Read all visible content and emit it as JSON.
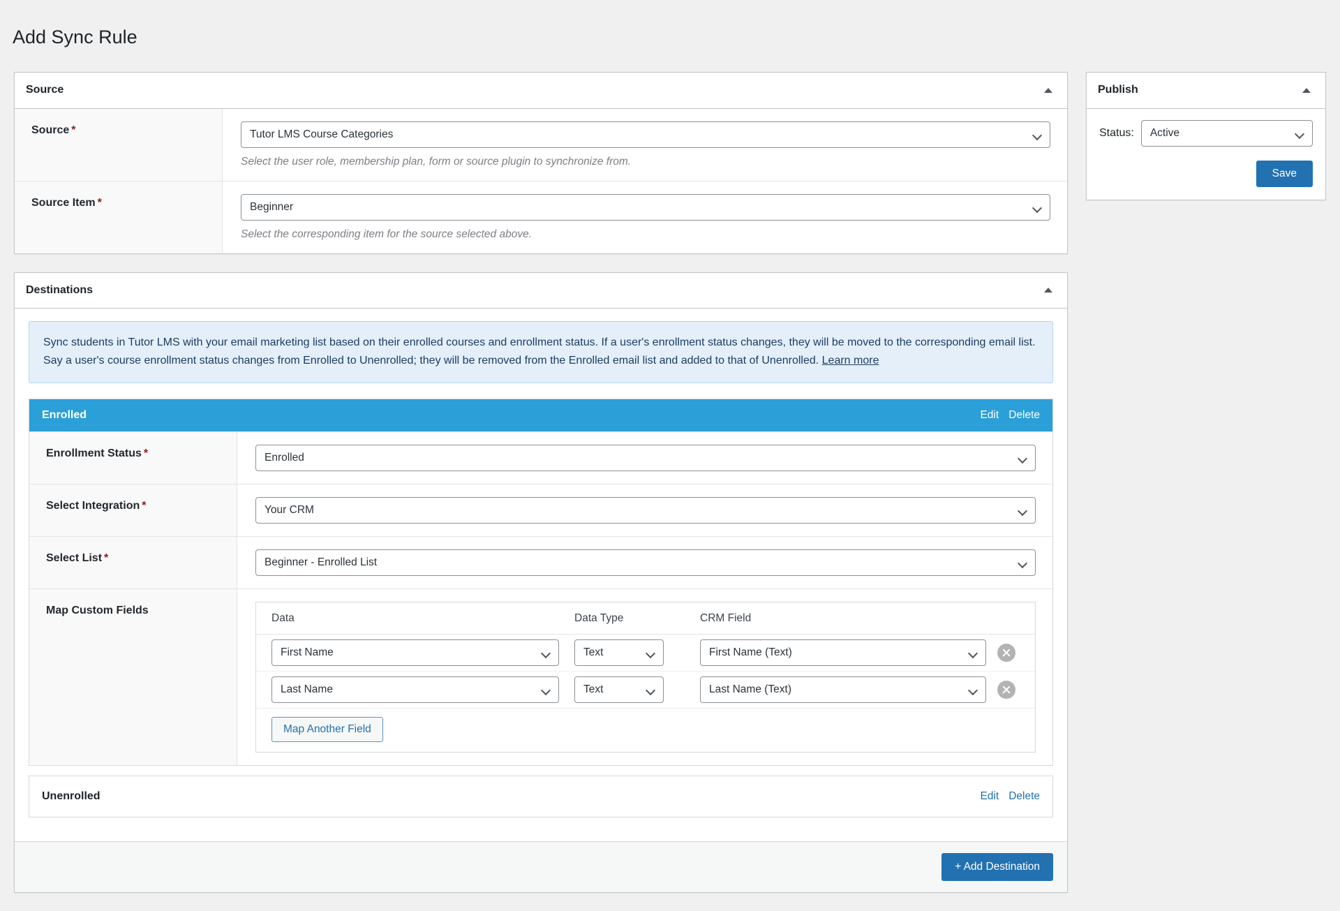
{
  "page": {
    "title": "Add Sync Rule"
  },
  "source_panel": {
    "heading": "Source",
    "toggle_icon": "triangle-up-icon",
    "rows": [
      {
        "label": "Source",
        "required": "*",
        "value": "Tutor LMS Course Categories",
        "help": "Select the user role, membership plan, form or source plugin to synchronize from."
      },
      {
        "label": "Source Item",
        "required": "*",
        "value": "Beginner",
        "help": "Select the corresponding item for the source selected above."
      }
    ]
  },
  "destinations_panel": {
    "heading": "Destinations",
    "toggle_icon": "triangle-up-icon",
    "notice": {
      "text": "Sync students in Tutor LMS with your email marketing list based on their enrolled courses and enrollment status. If a user's enrollment status changes, they will be moved to the corresponding email list. Say a user's course enrollment status changes from Enrolled to Unenrolled; they will be removed from the Enrolled email list and added to that of Unenrolled. ",
      "link_label": "Learn more"
    },
    "enrolled": {
      "title": "Enrolled",
      "edit_label": "Edit",
      "delete_label": "Delete",
      "rows": [
        {
          "label": "Enrollment Status",
          "required": "*",
          "value": "Enrolled"
        },
        {
          "label": "Select Integration",
          "required": "*",
          "value": "Your CRM"
        },
        {
          "label": "Select List",
          "required": "*",
          "value": "Beginner - Enrolled List"
        }
      ],
      "map_fields": {
        "label": "Map Custom Fields",
        "columns": [
          "Data",
          "Data Type",
          "CRM Field"
        ],
        "rows": [
          {
            "data": "First Name",
            "data_type": "Text",
            "crm_field": "First Name (Text)",
            "remove_icon": "close-circle-icon"
          },
          {
            "data": "Last Name",
            "data_type": "Text",
            "crm_field": "Last Name (Text)",
            "remove_icon": "close-circle-icon"
          }
        ],
        "add_label": "Map Another Field"
      }
    },
    "unenrolled": {
      "title": "Unenrolled",
      "edit_label": "Edit",
      "delete_label": "Delete"
    },
    "add_destination_label": "+ Add Destination"
  },
  "publish_panel": {
    "heading": "Publish",
    "toggle_icon": "triangle-up-icon",
    "status_label": "Status:",
    "status_value": "Active",
    "save_label": "Save"
  },
  "colors": {
    "accent_blue": "#2271b1",
    "dest_header_blue": "#2b9fd8",
    "notice_bg": "#e4effa",
    "required_red": "#8c1a1a",
    "page_bg": "#f0f0f1"
  }
}
